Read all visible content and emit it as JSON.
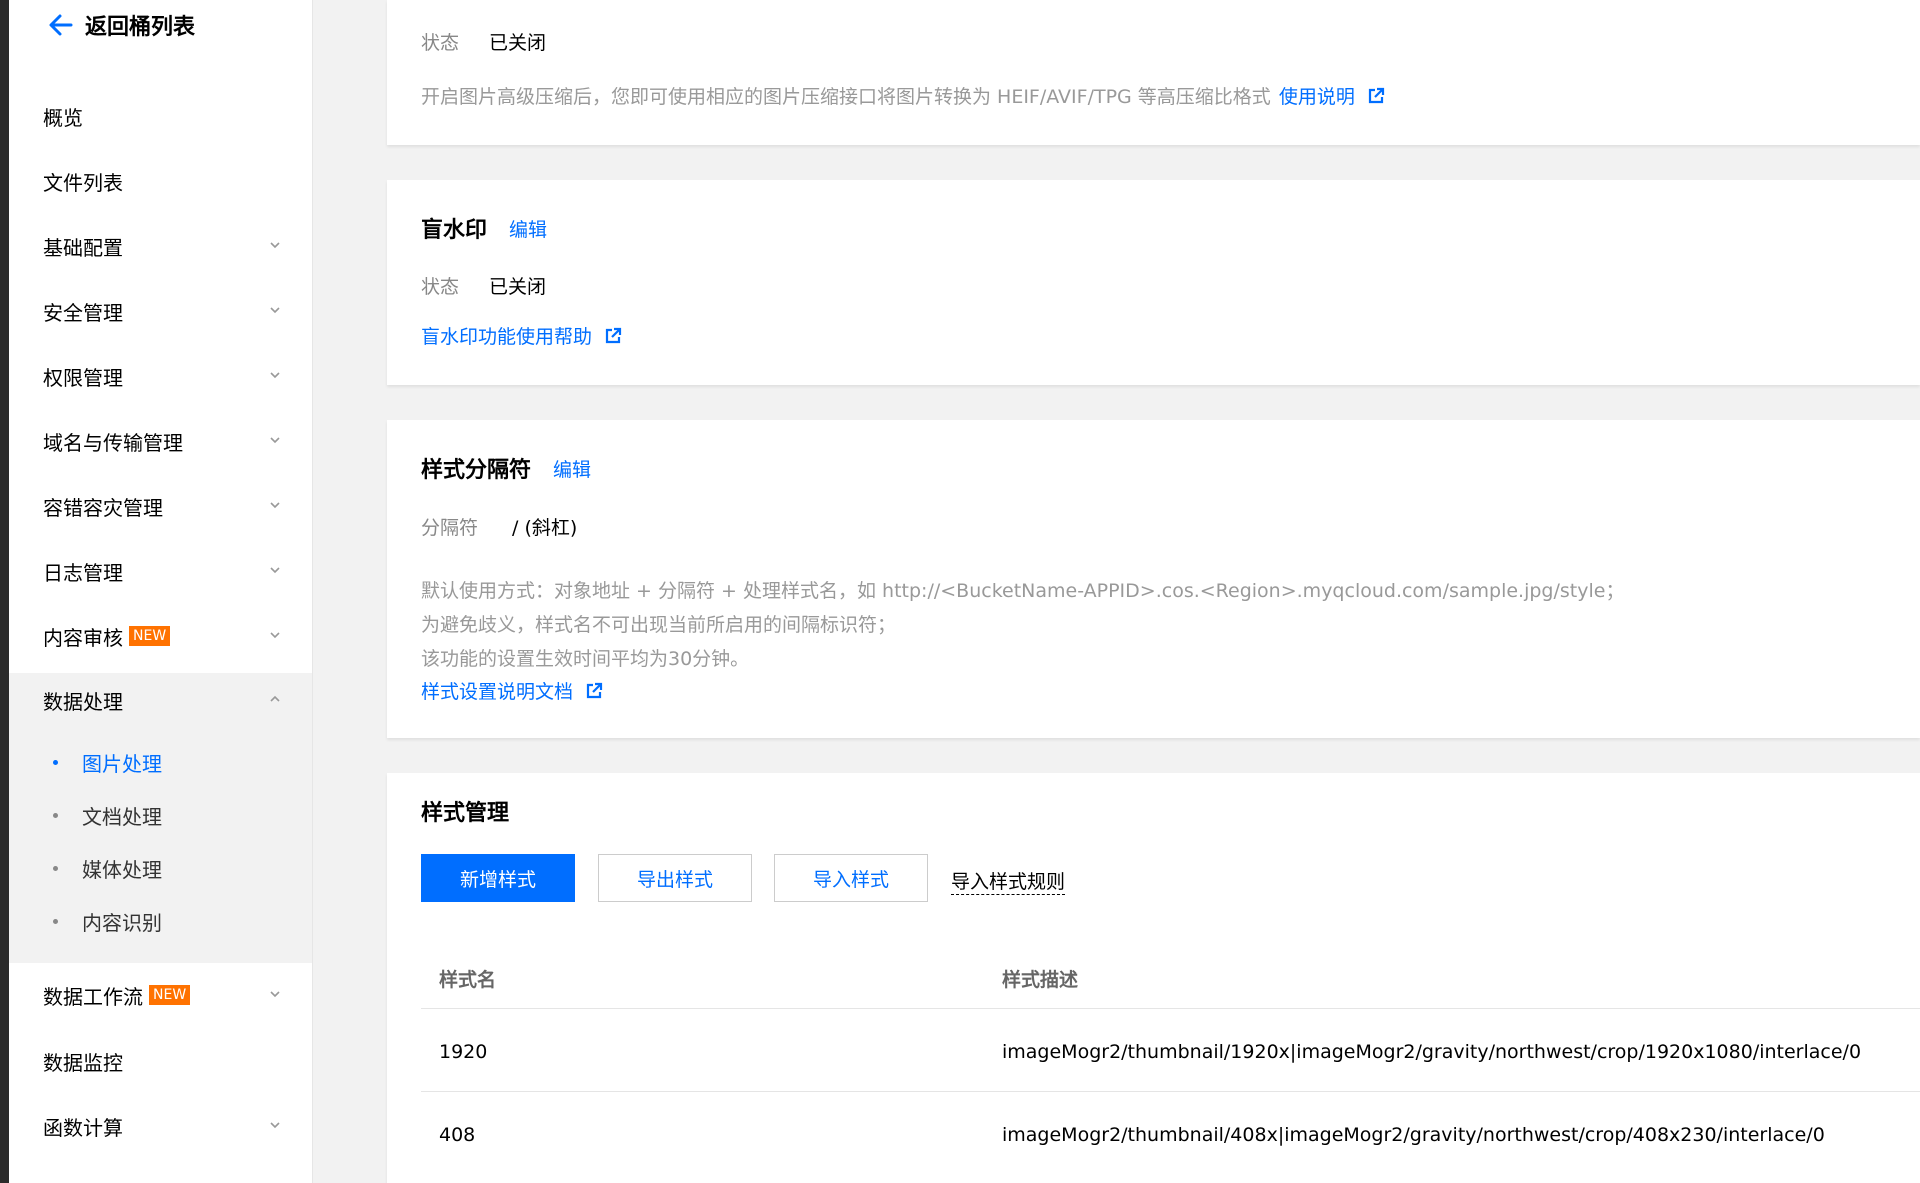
{
  "sidebar": {
    "back_label": "返回桶列表",
    "items": [
      {
        "label": "概览"
      },
      {
        "label": "文件列表"
      },
      {
        "label": "基础配置"
      },
      {
        "label": "安全管理"
      },
      {
        "label": "权限管理"
      },
      {
        "label": "域名与传输管理"
      },
      {
        "label": "容错容灾管理"
      },
      {
        "label": "日志管理"
      },
      {
        "label": "内容审核",
        "badge": "NEW"
      },
      {
        "label": "数据处理"
      },
      {
        "label": "数据工作流",
        "badge": "NEW"
      },
      {
        "label": "数据监控"
      },
      {
        "label": "函数计算"
      }
    ],
    "sub_items": [
      {
        "label": "图片处理"
      },
      {
        "label": "文档处理"
      },
      {
        "label": "媒体处理"
      },
      {
        "label": "内容识别"
      }
    ],
    "colors": {
      "accent": "#006eff",
      "badge": "#ff7200"
    }
  },
  "compress": {
    "status_key": "状态",
    "status_value": "已关闭",
    "desc": "开启图片高级压缩后，您即可使用相应的图片压缩接口将图片转换为 HEIF/AVIF/TPG 等高压缩比格式",
    "help_link": "使用说明"
  },
  "watermark": {
    "title": "盲水印",
    "edit": "编辑",
    "status_key": "状态",
    "status_value": "已关闭",
    "help_link": "盲水印功能使用帮助"
  },
  "separator": {
    "title": "样式分隔符",
    "edit": "编辑",
    "key": "分隔符",
    "value": "/ (斜杠)",
    "desc1": "默认使用方式：对象地址 + 分隔符 + 处理样式名，如 http://<BucketName-APPID>.cos.<Region>.myqcloud.com/sample.jpg/style；",
    "desc2": "为避免歧义，样式名不可出现当前所启用的间隔标识符；",
    "desc3": "该功能的设置生效时间平均为30分钟。",
    "doc_link": "样式设置说明文档"
  },
  "styles": {
    "title": "样式管理",
    "add_button": "新增样式",
    "export_button": "导出样式",
    "import_button": "导入样式",
    "import_rules": "导入样式规则",
    "columns": [
      "样式名",
      "样式描述"
    ],
    "rows": [
      {
        "name": "1920",
        "desc": "imageMogr2/thumbnail/1920x|imageMogr2/gravity/northwest/crop/1920x1080/interlace/0"
      },
      {
        "name": "408",
        "desc": "imageMogr2/thumbnail/408x|imageMogr2/gravity/northwest/crop/408x230/interlace/0"
      }
    ]
  }
}
